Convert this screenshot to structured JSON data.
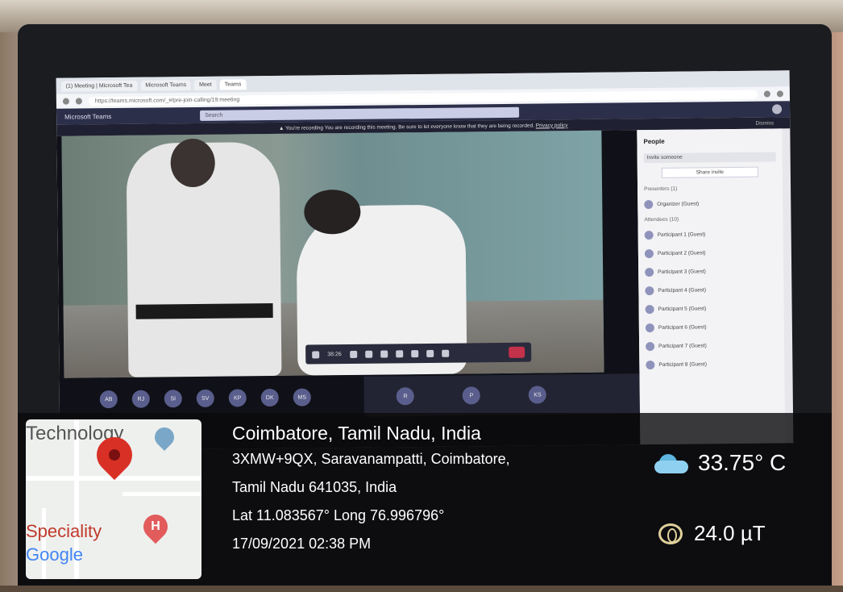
{
  "browser": {
    "tabs": [
      "(1) Meeting | Microsoft Tea",
      "Microsoft Teams",
      "Meet",
      "Teams"
    ],
    "url": "https://teams.microsoft.com/_#/pre-join-calling/19:meeting"
  },
  "teams": {
    "app_name": "Microsoft Teams",
    "search_placeholder": "Search",
    "recording_notice": "▲ You're recording  You are recording this meeting. Be sure to let everyone know that they are being recorded.",
    "privacy_link": "Privacy policy",
    "dismiss": "Dismiss",
    "call_time": "38:26",
    "people_title": "People",
    "invite_placeholder": "Invite someone",
    "share_invite": "Share invite",
    "presenters_header": "Presenters (1)",
    "attendees_header": "Attendees (10)",
    "participants": [
      "Organizer (Guest)",
      "Participant 1 (Guest)",
      "Participant 2 (Guest)",
      "Participant 3 (Guest)",
      "Participant 4 (Guest)",
      "Participant 5 (Guest)",
      "Participant 6 (Guest)",
      "Participant 7 (Guest)",
      "Participant 8 (Guest)"
    ],
    "gallery_initials": [
      "AB",
      "RJ",
      "SI",
      "SV",
      "KP",
      "DK",
      "MS"
    ],
    "gallery_right_initials": [
      "R",
      "P",
      "KS"
    ]
  },
  "overlay": {
    "map_text_top": "Technology",
    "map_text_bottom": "Speciality",
    "map_logo": "Google",
    "hospital_marker": "H",
    "city_line": "Coimbatore, Tamil Nadu, India",
    "address_line1": "3XMW+9QX, Saravanampatti, Coimbatore,",
    "address_line2": "Tamil Nadu 641035, India",
    "coords": "Lat 11.083567° Long 76.996796°",
    "datetime": "17/09/2021 02:38 PM",
    "temperature": "33.75° C",
    "magnetic": "24.0 µT"
  }
}
